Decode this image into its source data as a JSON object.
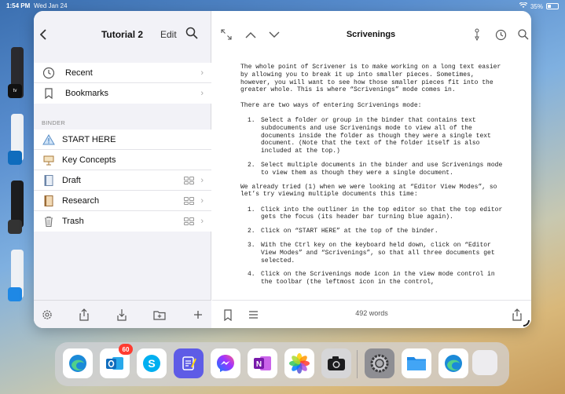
{
  "status_bar": {
    "time": "1:54 PM",
    "date": "Wed Jan 24",
    "battery": "35%",
    "battery_level": 0.35
  },
  "sidebar": {
    "title": "Tutorial 2",
    "edit_label": "Edit",
    "items": [
      {
        "label": "Recent",
        "icon": "clock-icon"
      },
      {
        "label": "Bookmarks",
        "icon": "bookmark-icon"
      }
    ],
    "binder_heading": "BINDER",
    "binder_items": [
      {
        "label": "START HERE",
        "icon": "warning-triangle-icon"
      },
      {
        "label": "Key Concepts",
        "icon": "presentation-icon"
      },
      {
        "label": "Draft",
        "icon": "draft-folder-icon"
      },
      {
        "label": "Research",
        "icon": "research-folder-icon"
      },
      {
        "label": "Trash",
        "icon": "trash-icon"
      }
    ]
  },
  "editor": {
    "title": "Scrivenings",
    "word_count": "492 words",
    "paragraphs": [
      "The whole point of Scrivener is to make working on a long text easier by allowing you to break it up into smaller pieces. Sometimes, however, you will want to see how those smaller pieces fit into the greater whole. This is where “Scrivenings” mode comes in.",
      "There are two ways of entering Scrivenings mode:"
    ],
    "list1": [
      {
        "num": "1.",
        "text": "Select a folder or group in the binder that contains text subdocuments and use Scrivenings mode to view all of the documents inside the folder as though they were a single text document. (Note that the text of the folder itself is also included at the top.)"
      },
      {
        "num": "2.",
        "text": "Select multiple documents in the binder and use Scrivenings mode to view them as though they were a single document."
      }
    ],
    "paragraph3": "We already tried (1) when we were looking at “Editor View Modes”, so let’s try viewing multiple documents this time:",
    "list2": [
      {
        "num": "1.",
        "text": "Click into the outliner in the top editor so that the top editor gets the focus (its header bar turning blue again)."
      },
      {
        "num": "2.",
        "text": "Click on “START HERE” at the top of the binder."
      },
      {
        "num": "3.",
        "text": "With the Ctrl key on the keyboard held down, click on “Editor View Modes” and “Scrivenings”, so that all three documents get selected."
      },
      {
        "num": "4.",
        "text": "Click on the Scrivenings mode icon in the view mode control in the toolbar (the leftmost icon in the control,"
      }
    ]
  },
  "dock": {
    "outlook_badge": "60",
    "apps": [
      "edge-icon",
      "outlook-icon",
      "skype-icon",
      "goodnotes-icon",
      "messenger-icon",
      "onenote-icon",
      "photos-icon",
      "camera-icon",
      "settings-icon",
      "files-icon",
      "edge-icon",
      "app-library-icon"
    ]
  },
  "colors": {
    "accent": "#007aff",
    "sidebar_bg": "#f2f2f7"
  }
}
